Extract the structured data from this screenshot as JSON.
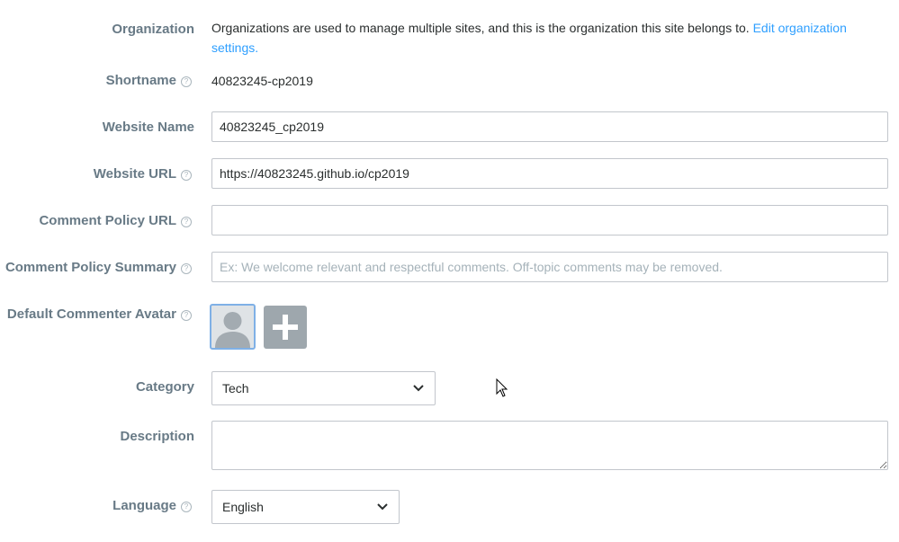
{
  "organization": {
    "label": "Organization",
    "text": "Organizations are used to manage multiple sites, and this is the organization this site belongs to.",
    "link_line1": "Edit organization",
    "link_line2": "settings."
  },
  "shortname": {
    "label": "Shortname",
    "value": "40823245-cp2019"
  },
  "website_name": {
    "label": "Website Name",
    "value": "40823245_cp2019"
  },
  "website_url": {
    "label": "Website URL",
    "value": "https://40823245.github.io/cp2019"
  },
  "comment_policy_url": {
    "label": "Comment Policy URL",
    "value": ""
  },
  "comment_policy_summary": {
    "label": "Comment Policy Summary",
    "placeholder": "Ex: We welcome relevant and respectful comments. Off-topic comments may be removed."
  },
  "default_avatar": {
    "label": "Default Commenter Avatar",
    "add_symbol": "+"
  },
  "category": {
    "label": "Category",
    "selected": "Tech"
  },
  "description": {
    "label": "Description",
    "value": ""
  },
  "language": {
    "label": "Language",
    "selected": "English"
  },
  "help_symbol": "?",
  "colors": {
    "link": "#2e9fff",
    "label": "#687a86",
    "avatar_border": "#7fb0e6"
  }
}
